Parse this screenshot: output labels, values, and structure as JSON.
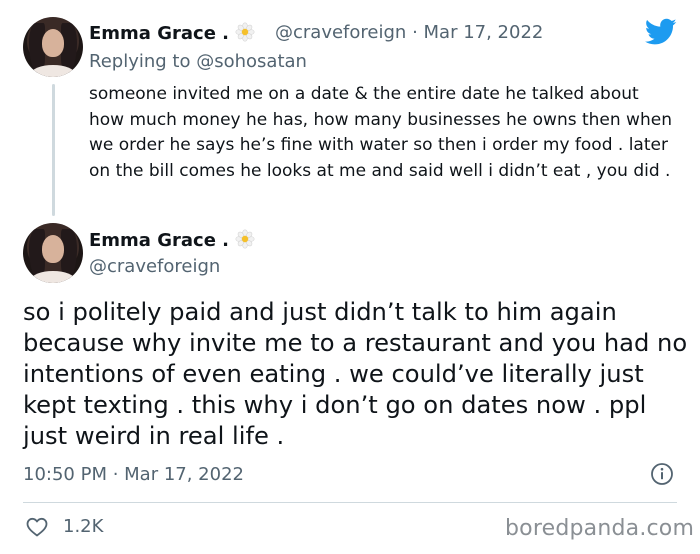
{
  "reply_tweet": {
    "author_name": "Emma Grace .",
    "author_emoji": "daisy-flower",
    "handle": "@craveforeign",
    "date": "· Mar 17, 2022",
    "replying_to_label": "Replying to",
    "replying_to_handle": "@sohosatan",
    "text": "someone invited me on a date & the entire date he talked about how much money he has, how many businesses he owns then when we order he says he’s fine with water so then i order my food . later on the bill comes he looks at me and said well i didn’t eat , you did ."
  },
  "main_tweet": {
    "author_name": "Emma Grace .",
    "author_emoji": "daisy-flower",
    "handle": "@craveforeign",
    "text": "so i politely paid and just didn’t talk to him again because why invite me to a restaurant and you had no intentions of even eating . we could’ve literally just kept texting . this why i don’t go on dates now . ppl just weird in real life .",
    "timestamp": "10:50 PM · Mar 17, 2022",
    "likes": "1.2K"
  },
  "watermark": "boredpanda.com",
  "colors": {
    "brand": "#1d9bf0",
    "text": "#0f1419",
    "muted": "#536471",
    "divider": "#cfd9de"
  },
  "icons": [
    "twitter-bird-icon",
    "daisy-flower-icon",
    "info-icon",
    "heart-icon"
  ]
}
